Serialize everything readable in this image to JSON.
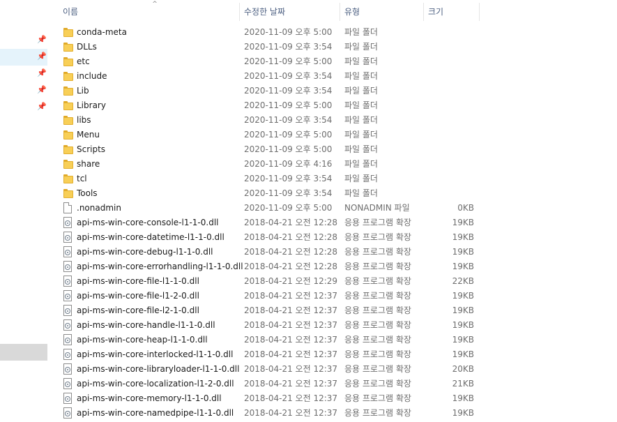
{
  "header": {
    "name": "이름",
    "date": "수정한 날짜",
    "type": "유형",
    "size": "크기",
    "sort_arrow": "^"
  },
  "nav": {
    "pin_icon": "📌"
  },
  "files": [
    {
      "icon": "folder-icon",
      "name": "conda-meta",
      "date": "2020-11-09 오후 5:00",
      "type": "파일 폴더",
      "size": ""
    },
    {
      "icon": "folder-icon",
      "name": "DLLs",
      "date": "2020-11-09 오후 3:54",
      "type": "파일 폴더",
      "size": ""
    },
    {
      "icon": "folder-icon",
      "name": "etc",
      "date": "2020-11-09 오후 5:00",
      "type": "파일 폴더",
      "size": ""
    },
    {
      "icon": "folder-icon",
      "name": "include",
      "date": "2020-11-09 오후 3:54",
      "type": "파일 폴더",
      "size": ""
    },
    {
      "icon": "folder-icon",
      "name": "Lib",
      "date": "2020-11-09 오후 3:54",
      "type": "파일 폴더",
      "size": ""
    },
    {
      "icon": "folder-icon",
      "name": "Library",
      "date": "2020-11-09 오후 5:00",
      "type": "파일 폴더",
      "size": ""
    },
    {
      "icon": "folder-icon",
      "name": "libs",
      "date": "2020-11-09 오후 3:54",
      "type": "파일 폴더",
      "size": ""
    },
    {
      "icon": "folder-icon",
      "name": "Menu",
      "date": "2020-11-09 오후 5:00",
      "type": "파일 폴더",
      "size": ""
    },
    {
      "icon": "folder-icon",
      "name": "Scripts",
      "date": "2020-11-09 오후 5:00",
      "type": "파일 폴더",
      "size": ""
    },
    {
      "icon": "folder-icon",
      "name": "share",
      "date": "2020-11-09 오후 4:16",
      "type": "파일 폴더",
      "size": ""
    },
    {
      "icon": "folder-icon",
      "name": "tcl",
      "date": "2020-11-09 오후 3:54",
      "type": "파일 폴더",
      "size": ""
    },
    {
      "icon": "folder-icon",
      "name": "Tools",
      "date": "2020-11-09 오후 3:54",
      "type": "파일 폴더",
      "size": ""
    },
    {
      "icon": "file-icon",
      "name": ".nonadmin",
      "date": "2020-11-09 오후 5:00",
      "type": "NONADMIN 파일",
      "size": "0KB"
    },
    {
      "icon": "dll-icon",
      "name": "api-ms-win-core-console-l1-1-0.dll",
      "date": "2018-04-21 오전 12:28",
      "type": "응용 프로그램 확장",
      "size": "19KB"
    },
    {
      "icon": "dll-icon",
      "name": "api-ms-win-core-datetime-l1-1-0.dll",
      "date": "2018-04-21 오전 12:28",
      "type": "응용 프로그램 확장",
      "size": "19KB"
    },
    {
      "icon": "dll-icon",
      "name": "api-ms-win-core-debug-l1-1-0.dll",
      "date": "2018-04-21 오전 12:28",
      "type": "응용 프로그램 확장",
      "size": "19KB"
    },
    {
      "icon": "dll-icon",
      "name": "api-ms-win-core-errorhandling-l1-1-0.dll",
      "date": "2018-04-21 오전 12:28",
      "type": "응용 프로그램 확장",
      "size": "19KB"
    },
    {
      "icon": "dll-icon",
      "name": "api-ms-win-core-file-l1-1-0.dll",
      "date": "2018-04-21 오전 12:29",
      "type": "응용 프로그램 확장",
      "size": "22KB"
    },
    {
      "icon": "dll-icon",
      "name": "api-ms-win-core-file-l1-2-0.dll",
      "date": "2018-04-21 오전 12:37",
      "type": "응용 프로그램 확장",
      "size": "19KB"
    },
    {
      "icon": "dll-icon",
      "name": "api-ms-win-core-file-l2-1-0.dll",
      "date": "2018-04-21 오전 12:37",
      "type": "응용 프로그램 확장",
      "size": "19KB"
    },
    {
      "icon": "dll-icon",
      "name": "api-ms-win-core-handle-l1-1-0.dll",
      "date": "2018-04-21 오전 12:37",
      "type": "응용 프로그램 확장",
      "size": "19KB"
    },
    {
      "icon": "dll-icon",
      "name": "api-ms-win-core-heap-l1-1-0.dll",
      "date": "2018-04-21 오전 12:37",
      "type": "응용 프로그램 확장",
      "size": "19KB"
    },
    {
      "icon": "dll-icon",
      "name": "api-ms-win-core-interlocked-l1-1-0.dll",
      "date": "2018-04-21 오전 12:37",
      "type": "응용 프로그램 확장",
      "size": "19KB"
    },
    {
      "icon": "dll-icon",
      "name": "api-ms-win-core-libraryloader-l1-1-0.dll",
      "date": "2018-04-21 오전 12:37",
      "type": "응용 프로그램 확장",
      "size": "20KB"
    },
    {
      "icon": "dll-icon",
      "name": "api-ms-win-core-localization-l1-2-0.dll",
      "date": "2018-04-21 오전 12:37",
      "type": "응용 프로그램 확장",
      "size": "21KB"
    },
    {
      "icon": "dll-icon",
      "name": "api-ms-win-core-memory-l1-1-0.dll",
      "date": "2018-04-21 오전 12:37",
      "type": "응용 프로그램 확장",
      "size": "19KB"
    },
    {
      "icon": "dll-icon",
      "name": "api-ms-win-core-namedpipe-l1-1-0.dll",
      "date": "2018-04-21 오전 12:37",
      "type": "응용 프로그램 확장",
      "size": "19KB"
    }
  ]
}
